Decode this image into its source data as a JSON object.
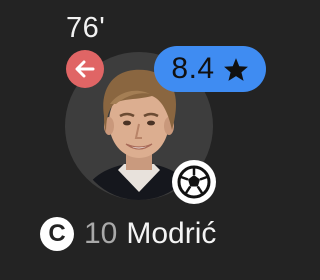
{
  "player": {
    "minute": "76'",
    "rating": "8.4",
    "captain_badge": "C",
    "number": "10",
    "name": "Modrić"
  },
  "icons": {
    "substitution": "arrow-left-icon",
    "rating": "star-icon",
    "goal": "soccer-ball-icon"
  },
  "colors": {
    "background": "#232323",
    "substitution_badge": "#e06565",
    "rating_badge": "#3f8cf2",
    "number_text": "#a9a9a9"
  }
}
